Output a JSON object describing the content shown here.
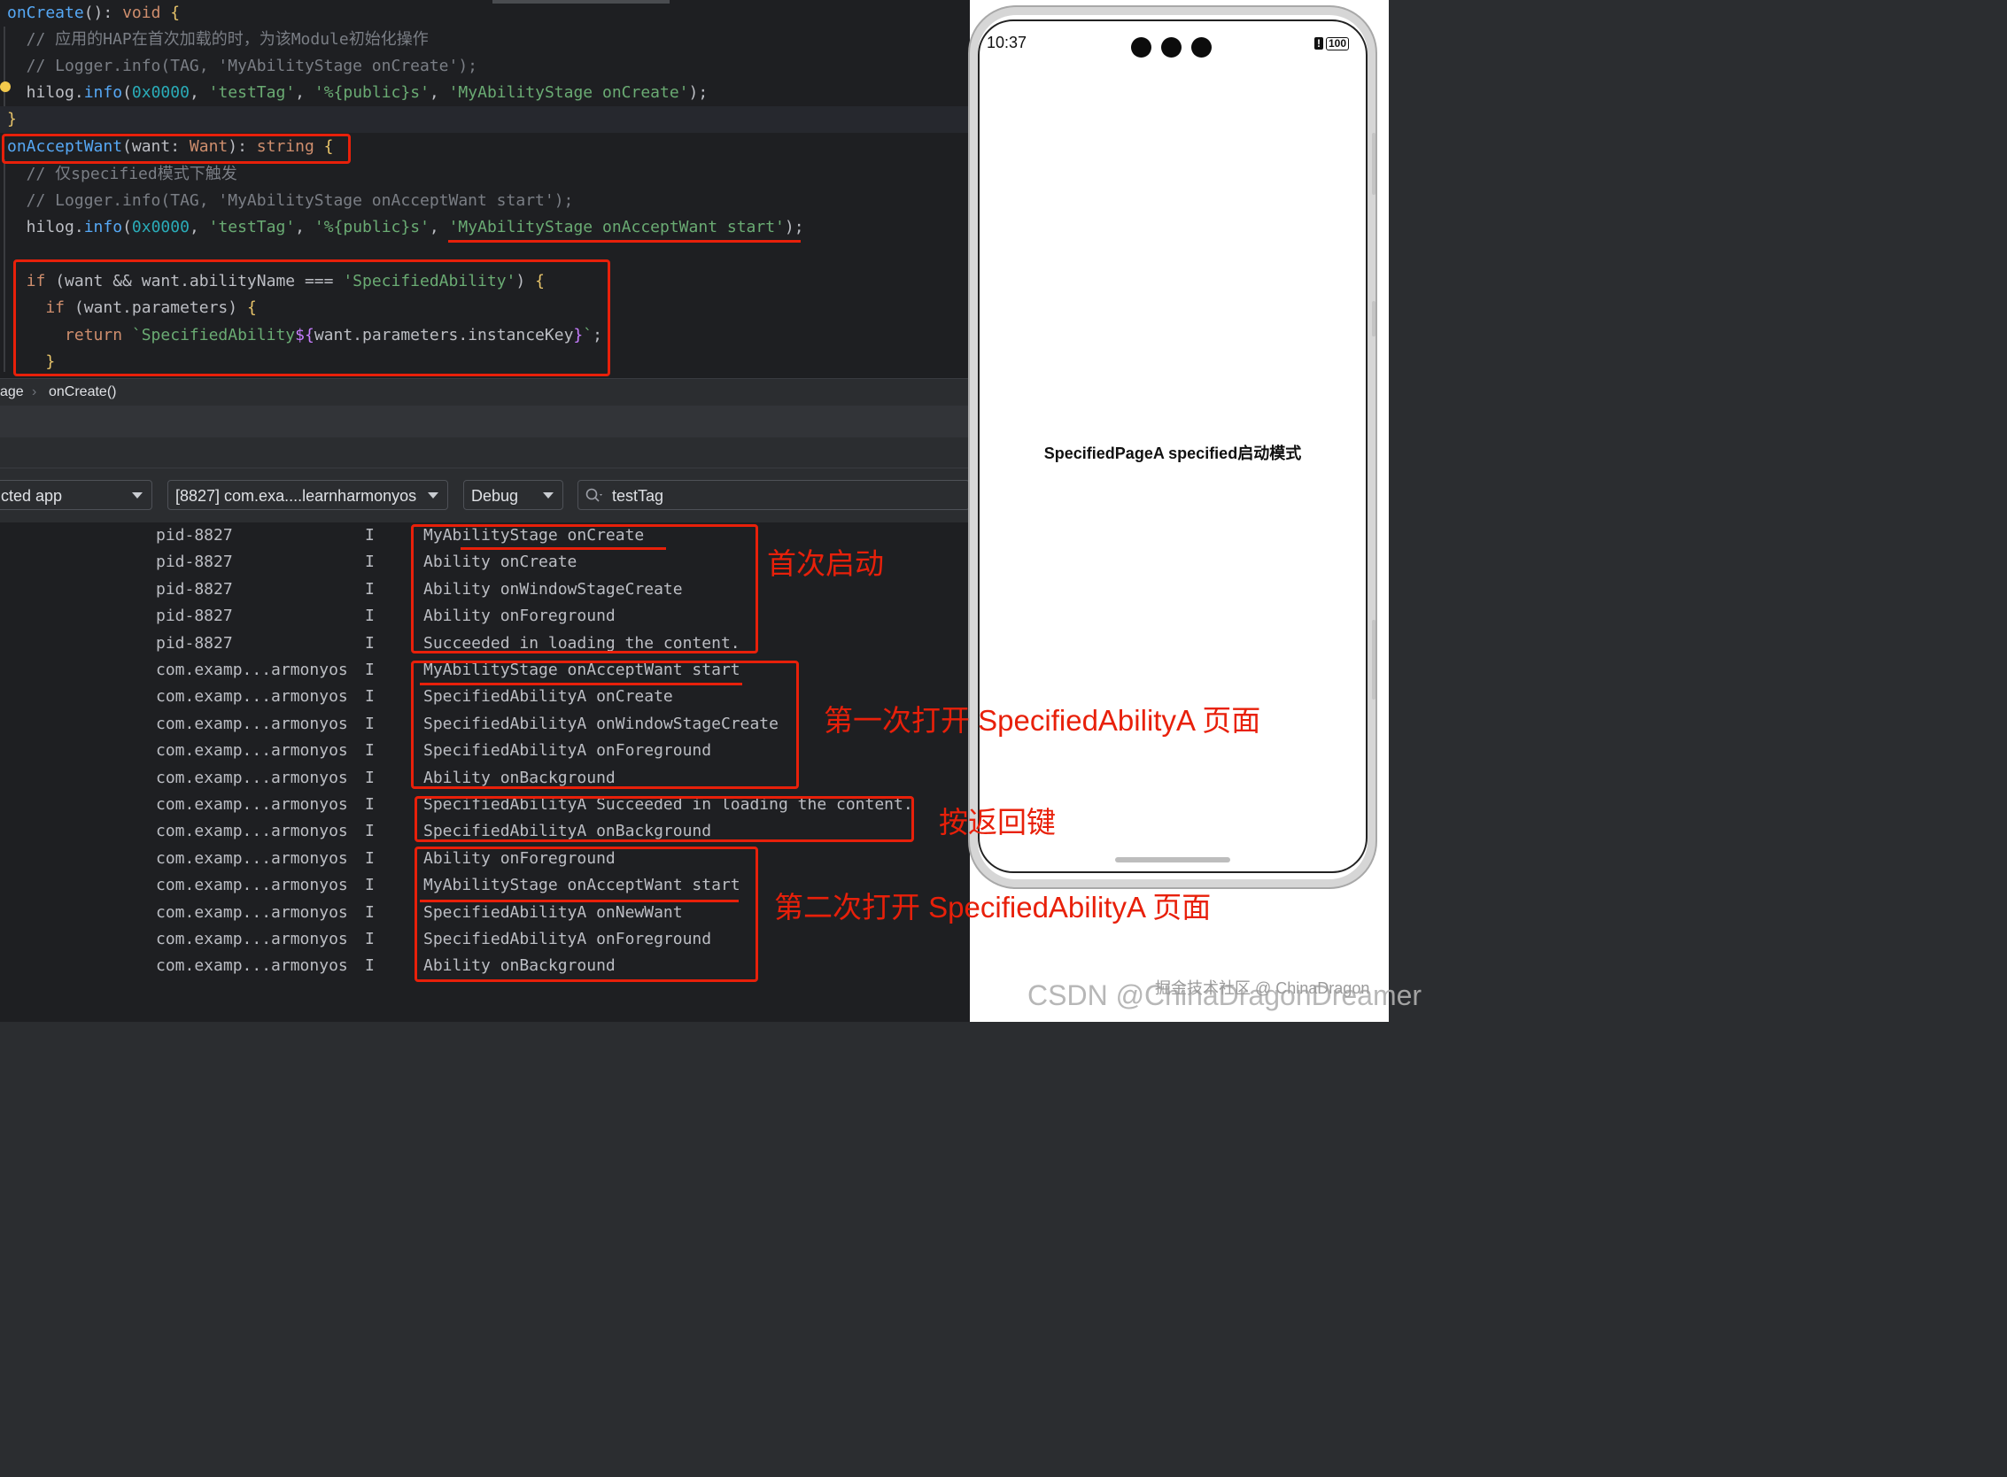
{
  "editor": {
    "lines": [
      {
        "parts": [
          [
            "fn",
            "onCreate"
          ],
          [
            "",
            "(): "
          ],
          [
            "type",
            "void"
          ],
          [
            "brace",
            " {"
          ]
        ]
      },
      {
        "parts": [
          [
            "cm",
            "  // 应用的HAP在首次加载的时，为该Module初始化操作"
          ]
        ]
      },
      {
        "parts": [
          [
            "cm",
            "  // Logger.info(TAG, 'MyAbilityStage onCreate');"
          ]
        ]
      },
      {
        "parts": [
          [
            "",
            "  hilog."
          ],
          [
            "fn",
            "info"
          ],
          [
            "",
            "("
          ],
          [
            "num",
            "0x0000"
          ],
          [
            "",
            ", "
          ],
          [
            "str",
            "'testTag'"
          ],
          [
            "",
            ", "
          ],
          [
            "str",
            "'%{public}s'"
          ],
          [
            "",
            ", "
          ],
          [
            "str",
            "'MyAbilityStage onCreate'"
          ],
          [
            "",
            ");"
          ]
        ]
      },
      {
        "parts": [
          [
            "brace",
            "}"
          ]
        ]
      },
      {
        "parts": [
          [
            "fn",
            "onAcceptWant"
          ],
          [
            "",
            "(want: "
          ],
          [
            "type",
            "Want"
          ],
          [
            "",
            "): "
          ],
          [
            "type",
            "string"
          ],
          [
            "brace",
            " {"
          ]
        ]
      },
      {
        "parts": [
          [
            "cm",
            "  // 仅specified模式下触发"
          ]
        ]
      },
      {
        "parts": [
          [
            "cm",
            "  // Logger.info(TAG, 'MyAbilityStage onAcceptWant start');"
          ]
        ]
      },
      {
        "parts": [
          [
            "",
            "  hilog."
          ],
          [
            "fn",
            "info"
          ],
          [
            "",
            "("
          ],
          [
            "num",
            "0x0000"
          ],
          [
            "",
            ", "
          ],
          [
            "str",
            "'testTag'"
          ],
          [
            "",
            ", "
          ],
          [
            "str",
            "'%{public}s'"
          ],
          [
            "",
            ", "
          ],
          [
            "str",
            "'MyAbilityStage onAcceptWant start'"
          ],
          [
            "",
            ");"
          ]
        ]
      },
      {
        "parts": [
          [
            "",
            ""
          ]
        ]
      },
      {
        "parts": [
          [
            "kw",
            "  if"
          ],
          [
            "",
            " (want && want.abilityName === "
          ],
          [
            "str",
            "'SpecifiedAbility'"
          ],
          [
            "",
            ") "
          ],
          [
            "brace",
            "{"
          ]
        ]
      },
      {
        "parts": [
          [
            "kw",
            "    if"
          ],
          [
            "",
            " (want.parameters) "
          ],
          [
            "brace",
            "{"
          ]
        ]
      },
      {
        "parts": [
          [
            "kw",
            "      return"
          ],
          [
            "str",
            " `SpecifiedAbility"
          ],
          [
            "purple",
            "${"
          ],
          [
            "",
            "want.parameters.instanceKey"
          ],
          [
            "purple",
            "}"
          ],
          [
            "str",
            "`"
          ],
          [
            "",
            ";"
          ]
        ]
      },
      {
        "parts": [
          [
            "brace",
            "    }"
          ]
        ]
      }
    ]
  },
  "breadcrumb": {
    "parent": "age",
    "current": "onCreate()"
  },
  "logcat": {
    "device_filter": "cted app",
    "process_filter": "[8827] com.exa....learnharmonyos",
    "level_filter": "Debug",
    "search_value": "testTag",
    "rows": [
      {
        "tag": "pid-8827",
        "level": "I",
        "msg": "MyAbilityStage onCreate"
      },
      {
        "tag": "pid-8827",
        "level": "I",
        "msg": "Ability onCreate"
      },
      {
        "tag": "pid-8827",
        "level": "I",
        "msg": "Ability onWindowStageCreate"
      },
      {
        "tag": "pid-8827",
        "level": "I",
        "msg": "Ability onForeground"
      },
      {
        "tag": "pid-8827",
        "level": "I",
        "msg": "Succeeded in loading the content."
      },
      {
        "tag": "com.examp...armonyos",
        "level": "I",
        "msg": "MyAbilityStage onAcceptWant start"
      },
      {
        "tag": "com.examp...armonyos",
        "level": "I",
        "msg": "SpecifiedAbilityA onCreate"
      },
      {
        "tag": "com.examp...armonyos",
        "level": "I",
        "msg": "SpecifiedAbilityA onWindowStageCreate"
      },
      {
        "tag": "com.examp...armonyos",
        "level": "I",
        "msg": "SpecifiedAbilityA onForeground"
      },
      {
        "tag": "com.examp...armonyos",
        "level": "I",
        "msg": "Ability onBackground"
      },
      {
        "tag": "com.examp...armonyos",
        "level": "I",
        "msg": "SpecifiedAbilityA Succeeded in loading the content."
      },
      {
        "tag": "com.examp...armonyos",
        "level": "I",
        "msg": "SpecifiedAbilityA onBackground"
      },
      {
        "tag": "com.examp...armonyos",
        "level": "I",
        "msg": "Ability onForeground"
      },
      {
        "tag": "com.examp...armonyos",
        "level": "I",
        "msg": "MyAbilityStage onAcceptWant start"
      },
      {
        "tag": "com.examp...armonyos",
        "level": "I",
        "msg": "SpecifiedAbilityA onNewWant"
      },
      {
        "tag": "com.examp...armonyos",
        "level": "I",
        "msg": "SpecifiedAbilityA onForeground"
      },
      {
        "tag": "com.examp...armonyos",
        "level": "I",
        "msg": "Ability onBackground"
      }
    ]
  },
  "annotations": {
    "first_launch": "首次启动",
    "first_open": "第一次打开 SpecifiedAbilityA 页面",
    "press_back": "按返回键",
    "second_open": "第二次打开 SpecifiedAbilityA 页面"
  },
  "phone": {
    "time": "10:37",
    "battery": "100",
    "page_text": "SpecifiedPageA specified启动模式"
  },
  "watermark": {
    "small": "掘金技术社区 @ ChinaDragon",
    "large": "CSDN @ChinaDragonDreamer"
  },
  "colors": {
    "annotation_red": "#e8200a",
    "editor_bg": "#1e1f22"
  },
  "icons": [
    "search-icon",
    "dropdown-arrow-icon",
    "lightbulb-icon"
  ]
}
